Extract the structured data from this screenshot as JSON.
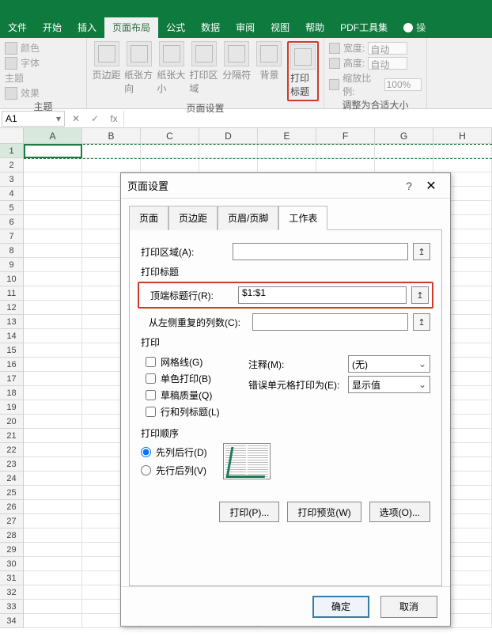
{
  "tabs": {
    "file": "文件",
    "home": "开始",
    "insert": "插入",
    "layout": "页面布局",
    "formulas": "公式",
    "data": "数据",
    "review": "审阅",
    "view": "视图",
    "help": "帮助",
    "pdf": "PDF工具集",
    "tell": "操"
  },
  "ribbon": {
    "themes": {
      "label": "主题",
      "color": "颜色",
      "font": "字体",
      "theme": "主题",
      "effect": "效果"
    },
    "pagesetup": {
      "label": "页面设置",
      "margins": "页边距",
      "orientation": "纸张方向",
      "size": "纸张大小",
      "printarea": "打印区域",
      "breaks": "分隔符",
      "background": "背景",
      "titles": "打印标题"
    },
    "scale": {
      "label": "调整为合适大小",
      "width": "宽度:",
      "height": "高度:",
      "scale": "缩放比例:",
      "auto": "自动",
      "pct": "100%"
    }
  },
  "namebox": "A1",
  "fx": "fx",
  "cols": [
    "A",
    "B",
    "C",
    "D",
    "E",
    "F",
    "G",
    "H"
  ],
  "dialog": {
    "title": "页面设置",
    "tabs": {
      "page": "页面",
      "margins": "页边距",
      "headerfooter": "页眉/页脚",
      "sheet": "工作表"
    },
    "printarea_label": "打印区域(A):",
    "titles_section": "打印标题",
    "rows_label": "顶端标题行(R):",
    "rows_value": "$1:$1",
    "cols_label": "从左侧重复的列数(C):",
    "print_section": "打印",
    "gridlines": "网格线(G)",
    "bw": "单色打印(B)",
    "draft": "草稿质量(Q)",
    "rowcol": "行和列标题(L)",
    "comments_label": "注释(M):",
    "comments_value": "(无)",
    "errors_label": "错误单元格打印为(E):",
    "errors_value": "显示值",
    "order_section": "打印顺序",
    "down_over": "先列后行(D)",
    "over_down": "先行后列(V)",
    "print_btn": "打印(P)...",
    "preview_btn": "打印预览(W)",
    "options_btn": "选项(O)...",
    "ok": "确定",
    "cancel": "取消"
  }
}
